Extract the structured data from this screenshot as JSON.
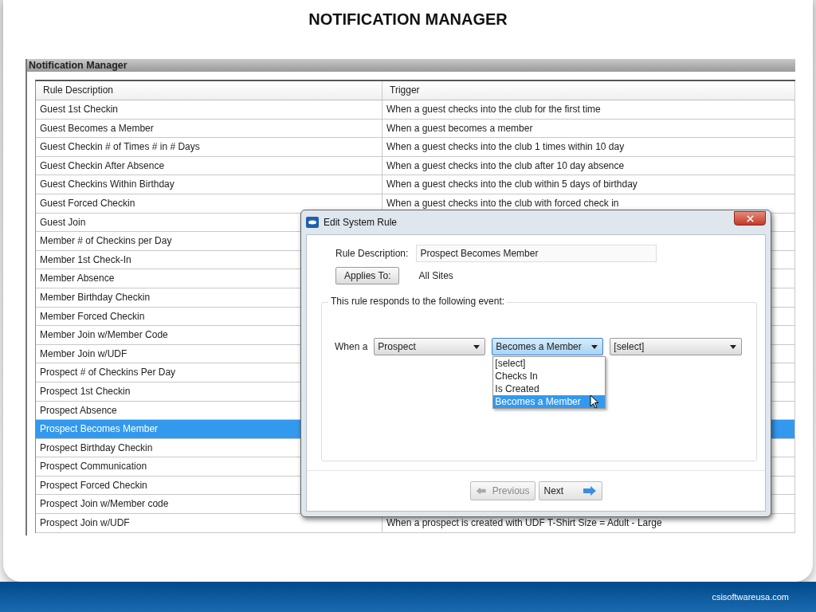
{
  "slide_title": "NOTIFICATION MANAGER",
  "panel_title": "Notification Manager",
  "table": {
    "columns": [
      "Rule Description",
      "Trigger"
    ],
    "rows": [
      {
        "description": "Guest 1st Checkin",
        "trigger": "When a guest checks into the club for the first time",
        "selected": false
      },
      {
        "description": "Guest Becomes a Member",
        "trigger": "When a guest becomes a member",
        "selected": false
      },
      {
        "description": "Guest Checkin # of Times # in # Days",
        "trigger": "When a guest checks into the club 1 times within 10 day",
        "selected": false
      },
      {
        "description": "Guest Checkin After Absence",
        "trigger": "When a guest checks into the club after 10 day absence",
        "selected": false
      },
      {
        "description": "Guest Checkins Within Birthday",
        "trigger": "When a guest checks into the club within 5 days of birthday",
        "selected": false
      },
      {
        "description": "Guest Forced Checkin",
        "trigger": "When a guest checks into the club with forced check in",
        "selected": false
      },
      {
        "description": "Guest Join",
        "selected": false
      },
      {
        "description": "Member # of Checkins per Day",
        "selected": false
      },
      {
        "description": "Member 1st Check-In",
        "selected": false
      },
      {
        "description": "Member Absence",
        "selected": false
      },
      {
        "description": "Member Birthday Checkin",
        "selected": false
      },
      {
        "description": "Member Forced Checkin",
        "selected": false
      },
      {
        "description": "Member Join w/Member Code",
        "selected": false
      },
      {
        "description": "Member Join w/UDF",
        "selected": false
      },
      {
        "description": "Prospect # of Checkins Per Day",
        "selected": false
      },
      {
        "description": "Prospect 1st Checkin",
        "selected": false
      },
      {
        "description": "Prospect Absence",
        "selected": false
      },
      {
        "description": "Prospect Becomes Member",
        "selected": true
      },
      {
        "description": "Prospect Birthday Checkin",
        "selected": false
      },
      {
        "description": "Prospect Communication",
        "selected": false
      },
      {
        "description": "Prospect Forced Checkin",
        "selected": false
      },
      {
        "description": "Prospect Join w/Member code",
        "selected": false
      },
      {
        "description": "Prospect Join w/UDF",
        "trigger": "When a prospect is created with UDF T-Shirt Size = Adult - Large",
        "selected": false
      }
    ]
  },
  "dialog": {
    "title": "Edit System Rule",
    "rule_description_label": "Rule Description:",
    "rule_description": "Prospect Becomes Member",
    "applies_to_button": "Applies To:",
    "applies_to_value": "All Sites",
    "event_legend": "This rule responds to the following event:",
    "when_label": "When a",
    "selects": [
      {
        "value": "Prospect",
        "open": false
      },
      {
        "value": "Becomes a Member",
        "open": true,
        "options": [
          {
            "label": "[select]",
            "selected": false
          },
          {
            "label": "Checks In",
            "selected": false
          },
          {
            "label": "Is Created",
            "selected": false
          },
          {
            "label": "Becomes a Member",
            "selected": true
          }
        ]
      },
      {
        "value": "[select]",
        "open": false
      }
    ],
    "buttons": [
      {
        "label": "Previous",
        "kind": "back",
        "disabled": true
      },
      {
        "label": "Next",
        "kind": "forward",
        "disabled": false
      }
    ]
  },
  "footer": "csisoftwareusa.com"
}
